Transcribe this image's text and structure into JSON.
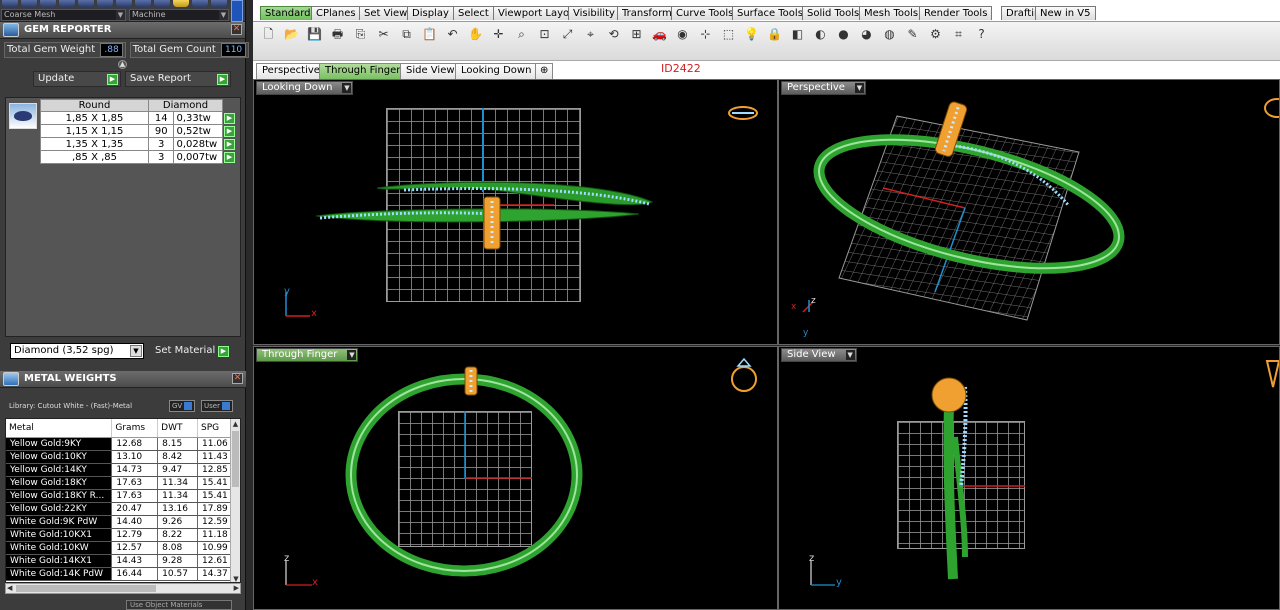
{
  "top_strip": {
    "select_left": "Coarse Mesh",
    "select_right": "Machine"
  },
  "gem_reporter": {
    "title": "GEM REPORTER",
    "total_weight_label": "Total Gem Weight",
    "total_weight_value": ".88",
    "total_count_label": "Total Gem Count",
    "total_count_value": "110",
    "update_label": "Update",
    "save_label": "Save Report",
    "header_shape": "Round",
    "header_material": "Diamond",
    "rows": [
      {
        "size": "1,85 X 1,85",
        "count": "14",
        "weight": "0,33tw"
      },
      {
        "size": "1,15 X 1,15",
        "count": "90",
        "weight": "0,52tw"
      },
      {
        "size": "1,35 X 1,35",
        "count": "3",
        "weight": "0,028tw"
      },
      {
        "size": ",85 X ,85",
        "count": "3",
        "weight": "0,007tw"
      }
    ],
    "material_select": "Diamond   (3,52 spg)",
    "set_material_label": "Set Material"
  },
  "metal_weights": {
    "title": "METAL WEIGHTS",
    "library": "Library: Cutout White - (Fast)-Metal",
    "btn_gv": "GV",
    "btn_user": "User",
    "columns": [
      "Metal",
      "Grams",
      "DWT",
      "SPG"
    ],
    "rows": [
      {
        "metal": "Yellow Gold:9KY",
        "grams": "12.68",
        "dwt": "8.15",
        "spg": "11.06"
      },
      {
        "metal": "Yellow Gold:10KY",
        "grams": "13.10",
        "dwt": "8.42",
        "spg": "11.43"
      },
      {
        "metal": "Yellow Gold:14KY",
        "grams": "14.73",
        "dwt": "9.47",
        "spg": "12.85"
      },
      {
        "metal": "Yellow Gold:18KY",
        "grams": "17.63",
        "dwt": "11.34",
        "spg": "15.41"
      },
      {
        "metal": "Yellow Gold:18KY R...",
        "grams": "17.63",
        "dwt": "11.34",
        "spg": "15.41"
      },
      {
        "metal": "Yellow Gold:22KY",
        "grams": "20.47",
        "dwt": "13.16",
        "spg": "17.89"
      },
      {
        "metal": "White Gold:9K PdW",
        "grams": "14.40",
        "dwt": "9.26",
        "spg": "12.59"
      },
      {
        "metal": "White Gold:10KX1",
        "grams": "12.79",
        "dwt": "8.22",
        "spg": "11.18"
      },
      {
        "metal": "White Gold:10KW",
        "grams": "12.57",
        "dwt": "8.08",
        "spg": "10.99"
      },
      {
        "metal": "White Gold:14KX1",
        "grams": "14.43",
        "dwt": "9.28",
        "spg": "12.61"
      },
      {
        "metal": "White Gold:14K PdW",
        "grams": "16.44",
        "dwt": "10.57",
        "spg": "14.37"
      }
    ],
    "use_object_materials": "Use Object Materials"
  },
  "toolbar_tabs": [
    "Standard",
    "CPlanes",
    "Set View",
    "Display",
    "Select",
    "Viewport Layout",
    "Visibility",
    "Transform",
    "Curve Tools",
    "Surface Tools",
    "Solid Tools",
    "Mesh Tools",
    "Render Tools",
    "Drafting",
    "New in V5"
  ],
  "toolbar_icons": [
    "new-icon",
    "open-icon",
    "save-icon",
    "print-icon",
    "import-icon",
    "cut-icon",
    "copy-icon",
    "paste-icon",
    "undo-icon",
    "pan-icon",
    "move-icon",
    "zoom-icon",
    "zoom-window-icon",
    "zoom-extents-icon",
    "zoom-selected-icon",
    "rotate-icon",
    "four-view-icon",
    "car-icon",
    "camera-icon",
    "grid-snap-icon",
    "select-icon",
    "light-icon",
    "lock-icon",
    "layer-icon",
    "color-wheel-icon",
    "sphere-icon",
    "render-icon",
    "shaded-icon",
    "pencil-icon",
    "gear-icon",
    "snap-icon",
    "help-icon"
  ],
  "view_tabs": [
    "Perspective",
    "Through Finger",
    "Side View",
    "Looking Down"
  ],
  "active_view_tab": "Through Finger",
  "id_label": "ID2422",
  "viewports": {
    "looking_down": "Looking Down",
    "perspective": "Perspective",
    "through_finger": "Through Finger",
    "side_view": "Side View"
  },
  "axis_labels": {
    "ld_y": "y",
    "ld_x": "x",
    "p_z": "z",
    "p_x": "x",
    "p_y": "y",
    "tf_z": "z",
    "tf_x": "x",
    "sv_z": "z",
    "sv_y": "y"
  },
  "colors": {
    "band": "#2fa32f",
    "band_highlight": "#9ee69e",
    "gold": "#f0a030",
    "stones": "#9fdcff",
    "axis_x": "#d02020",
    "axis_y": "#1f8fd0"
  }
}
